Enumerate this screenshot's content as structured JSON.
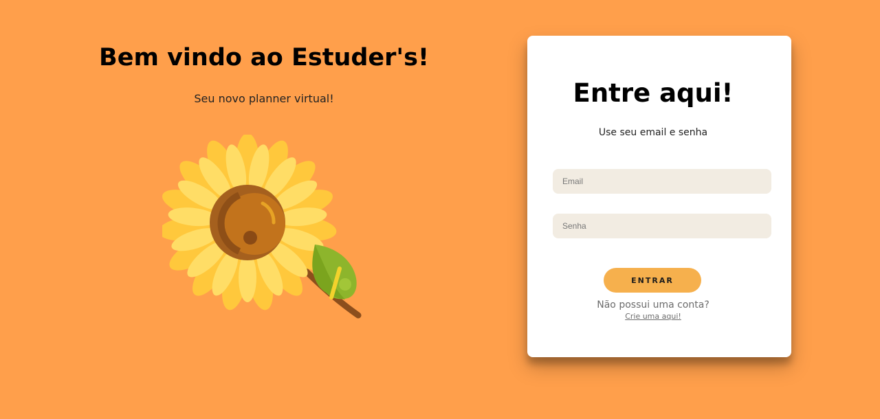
{
  "hero": {
    "title": "Bem vindo ao Estuder's!",
    "subtitle": "Seu novo planner virtual!"
  },
  "login": {
    "title": "Entre aqui!",
    "subtitle": "Use seu email e senha",
    "email_placeholder": "Email",
    "password_placeholder": "Senha",
    "submit_label": "ENTRAR",
    "signup_prompt": "Não possui uma conta?",
    "signup_link": "Crie uma aqui!"
  },
  "colors": {
    "background": "#FF9F4B",
    "card": "#FFFFFF",
    "input": "#F2ECE2",
    "button": "#F6B04D",
    "petal": "#FFD046",
    "seed": "#A5601E"
  },
  "icons": {
    "illustration": "sunflower-illustration"
  }
}
